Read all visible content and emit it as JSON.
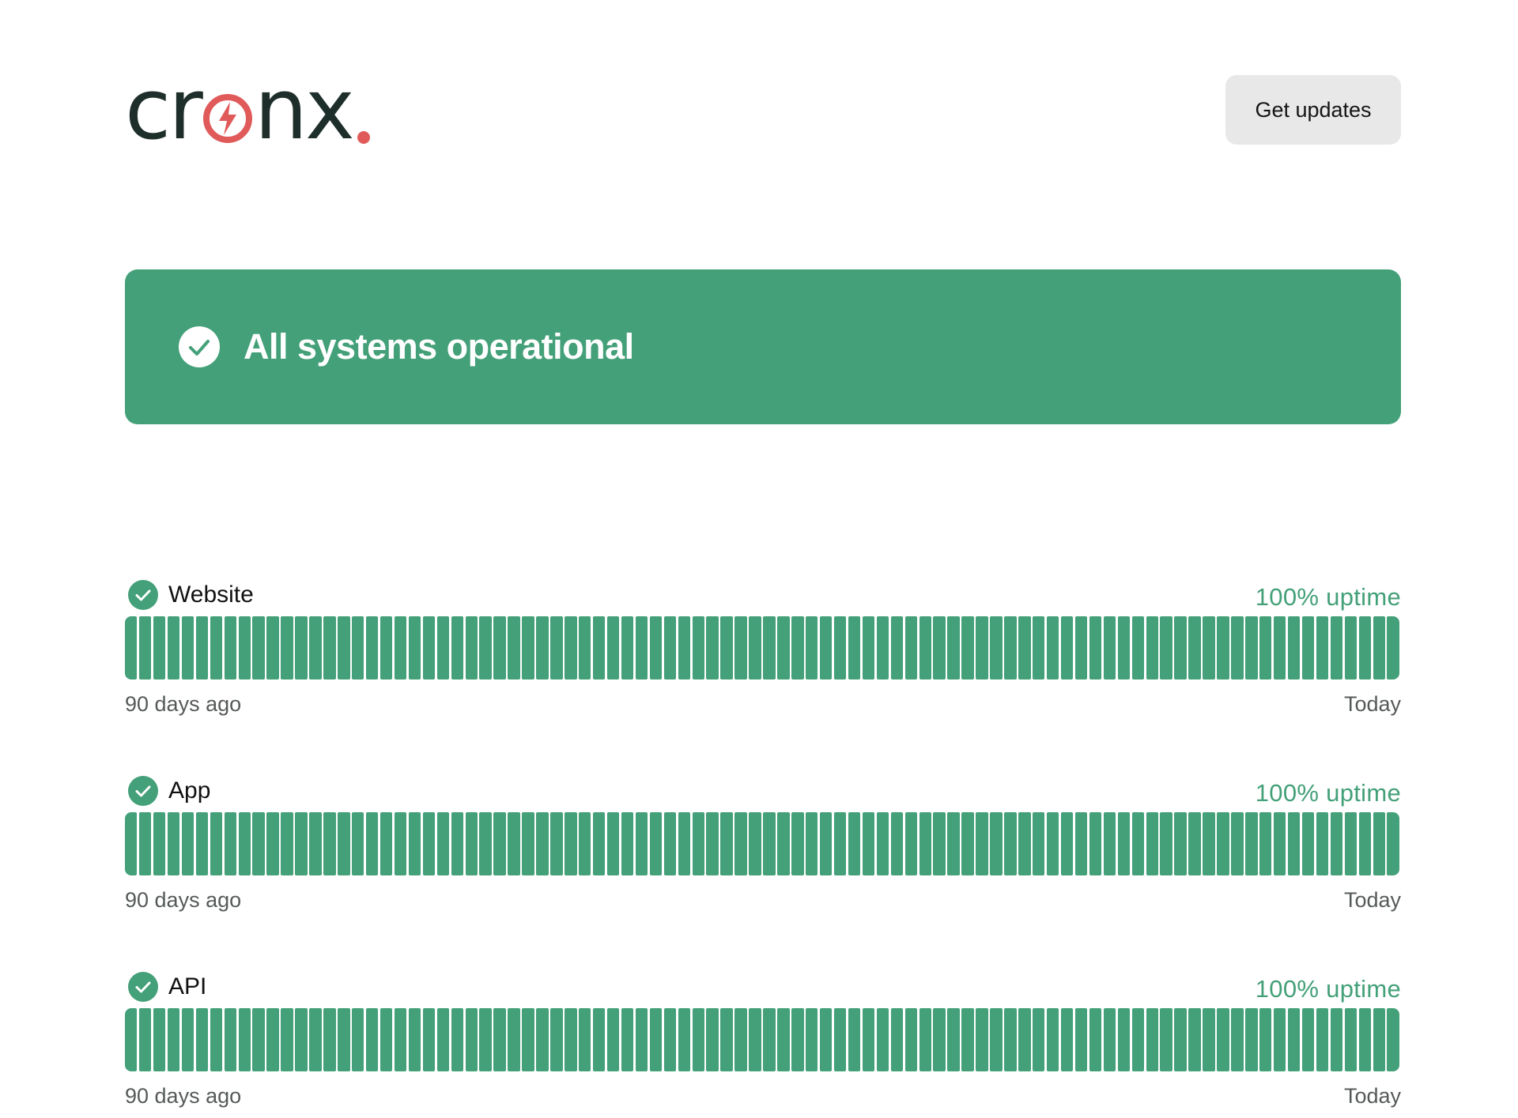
{
  "header": {
    "logo": {
      "text_before": "cr",
      "text_after": "nx",
      "dark_color": "#1e2e2a",
      "accent_color": "#e05a5a",
      "icon": "lightning-bolt-icon"
    },
    "get_updates_label": "Get updates"
  },
  "banner": {
    "title": "All systems operational",
    "background": "#43a078",
    "icon": "check-circle-icon"
  },
  "colors": {
    "operational": "#43a078",
    "bar_gap": "#ffffff"
  },
  "components": [
    {
      "name": "Website",
      "uptime": "100% uptime",
      "days": 90,
      "start_label": "90 days ago",
      "end_label": "Today"
    },
    {
      "name": "App",
      "uptime": "100% uptime",
      "days": 90,
      "start_label": "90 days ago",
      "end_label": "Today"
    },
    {
      "name": "API",
      "uptime": "100% uptime",
      "days": 90,
      "start_label": "90 days ago",
      "end_label": "Today"
    }
  ]
}
